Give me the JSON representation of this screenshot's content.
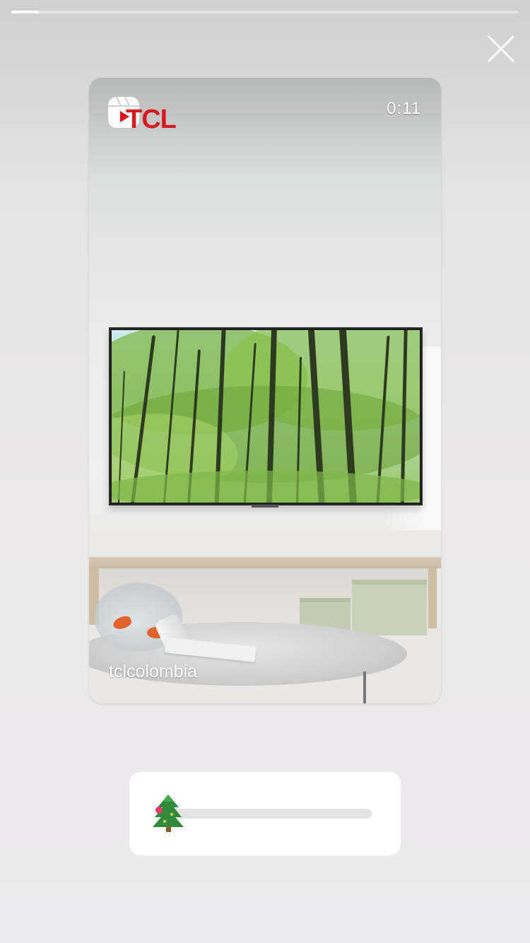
{
  "story": {
    "progress": 0.055,
    "close_icon": "close-icon"
  },
  "video": {
    "duration": "0:11",
    "brand_logo_text": "TCL",
    "brand_color": "#d71920",
    "reels_icon": "reels-icon",
    "username": "tclcolombia"
  },
  "slider_sticker": {
    "emoji": "🌲",
    "emoji_icon": "christmas-tree-icon",
    "value": 0.0
  }
}
